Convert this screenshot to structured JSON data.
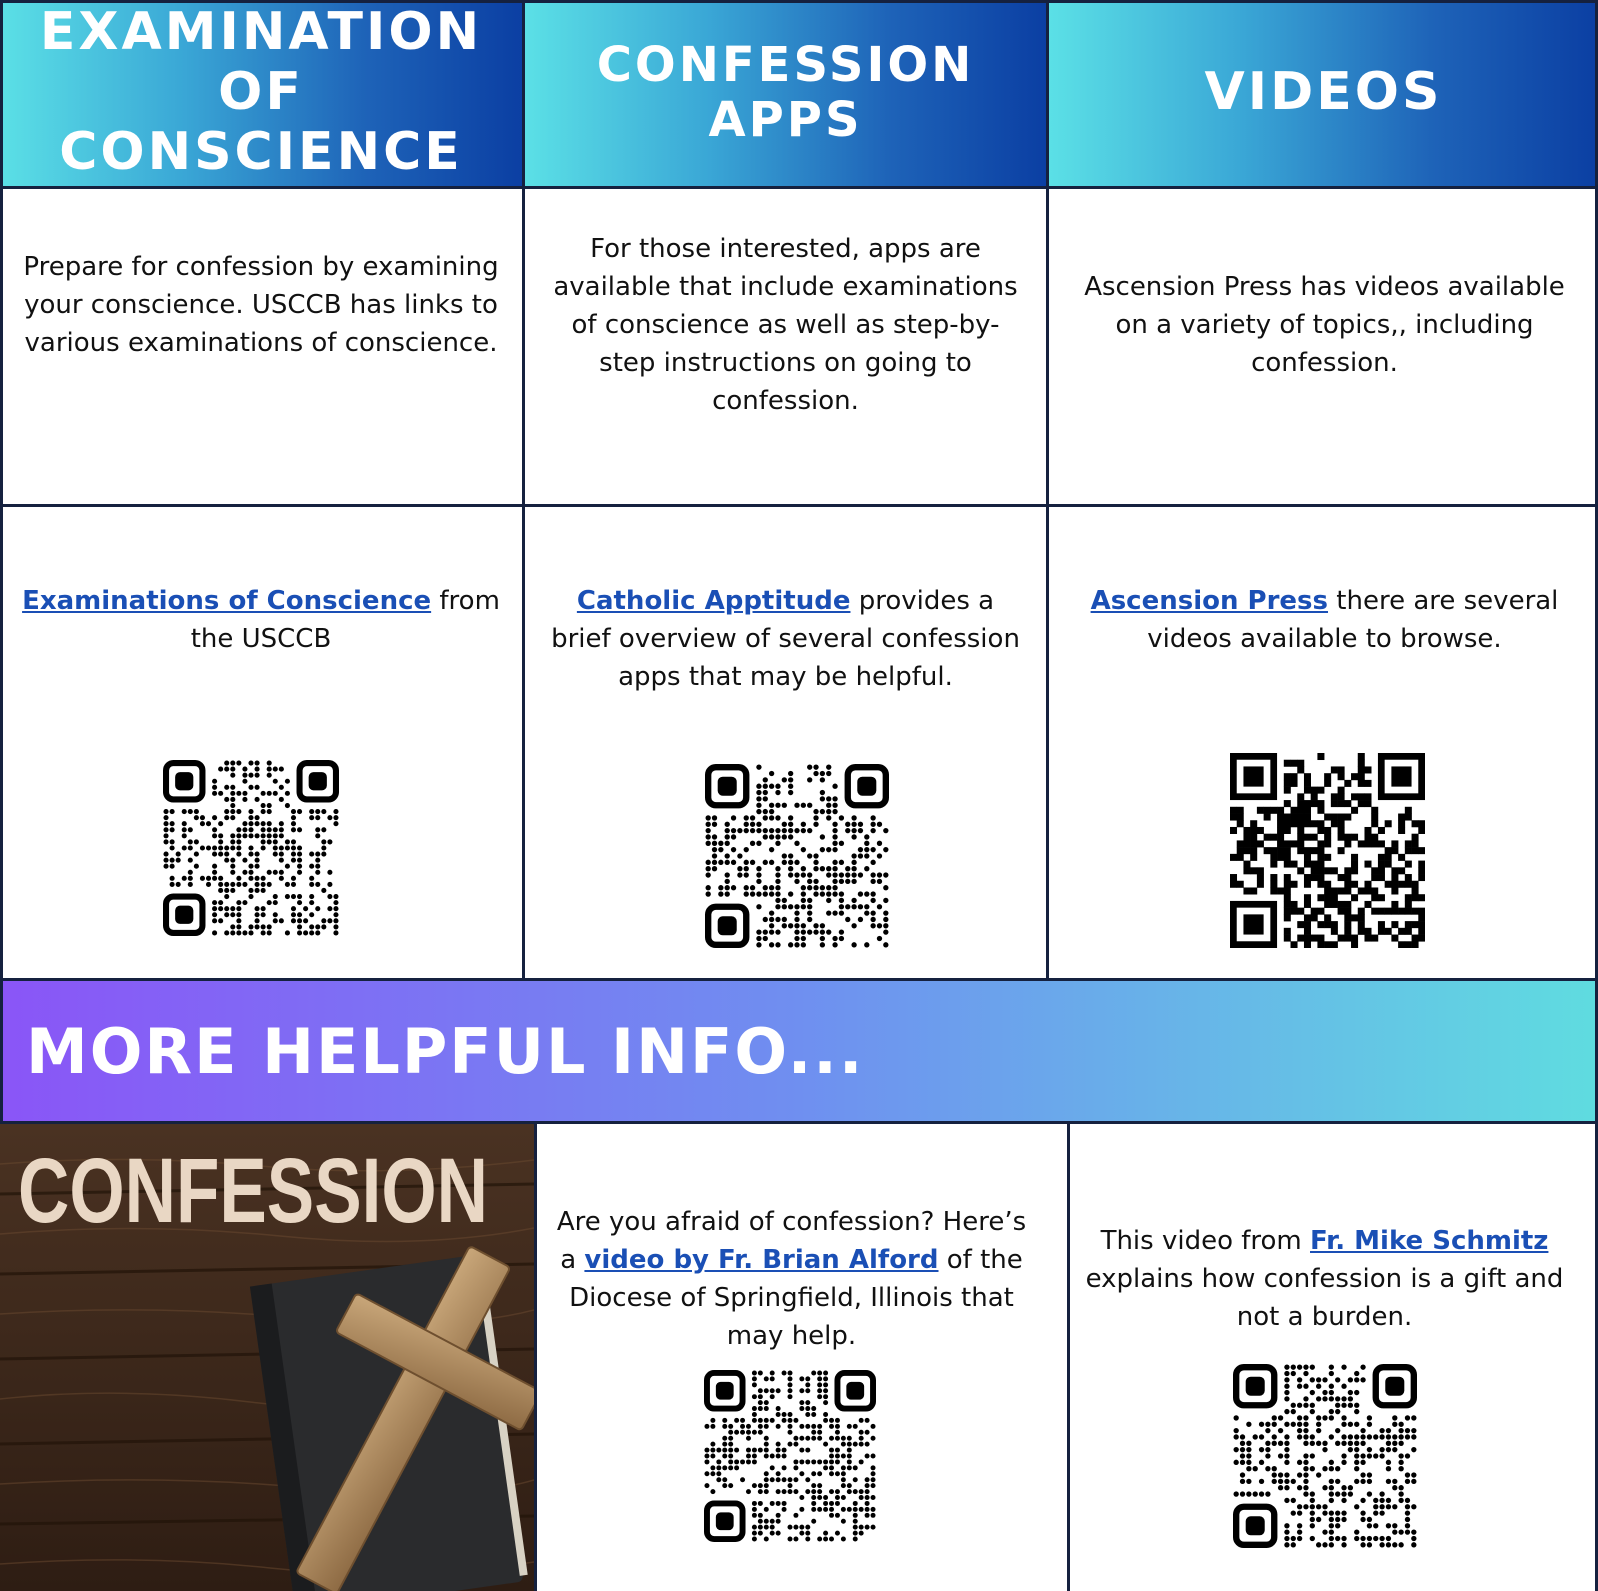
{
  "columns": [
    {
      "header": "EXAMINATION OF CONSCIENCE",
      "description": "Prepare for confession by examining your conscience. USCCB has links to various examinations of conscience.",
      "link_text": "Examinations of Conscience",
      "link_suffix": " from the USCCB"
    },
    {
      "header": "CONFESSION APPS",
      "description": "For those interested, apps are available that include examinations of conscience as well as step-by-step instructions on going to confession.",
      "link_text": "Catholic Apptitude",
      "link_suffix": " provides a brief overview of several confession apps that may be helpful."
    },
    {
      "header": "VIDEOS",
      "description": "Ascension Press has videos available on a variety of topics,, including confession.",
      "link_text": "Ascension Press",
      "link_suffix": " there are several videos available to browse."
    }
  ],
  "banner": {
    "title": "MORE HELPFUL INFO..."
  },
  "image": {
    "word": "CONFESSION"
  },
  "bottom": [
    {
      "prefix": "Are you afraid of confession? Here’s a ",
      "link_text": "video by Fr. Brian Alford",
      "suffix": " of the Diocese of Springfield, Illinois that may help."
    },
    {
      "prefix": "This video from ",
      "link_text": "Fr. Mike Schmitz",
      "suffix": " explains how confession is a gift and not a burden."
    }
  ],
  "icons": {
    "qr": "qr-code-icon",
    "cross": "cross-icon",
    "book": "book-icon"
  },
  "colors": {
    "link": "#1a4fb5",
    "border": "#15213f",
    "header_start": "#5be0e6",
    "header_end": "#0b3fa3",
    "banner_start": "#8a55f7",
    "banner_end": "#5fdce0"
  }
}
